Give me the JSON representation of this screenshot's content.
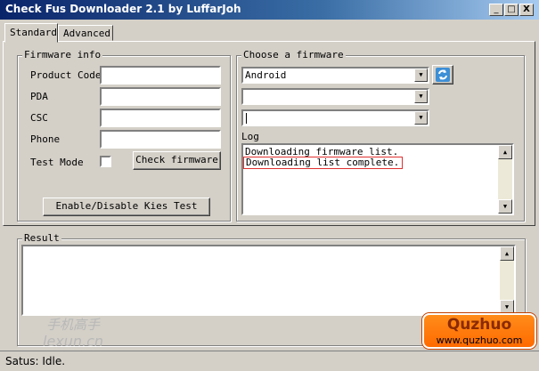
{
  "window": {
    "title": "Check Fus Downloader 2.1 by LuffarJoh"
  },
  "caption_buttons": {
    "minimize": "_",
    "maximize": "□",
    "close": "X"
  },
  "tabs": [
    {
      "label": "Standard",
      "active": true
    },
    {
      "label": "Advanced",
      "active": false
    }
  ],
  "firmware_info": {
    "legend": "Firmware info",
    "product_code_label": "Product Code",
    "product_code_value": "",
    "pda_label": "PDA",
    "pda_value": "",
    "csc_label": "CSC",
    "csc_value": "",
    "phone_label": "Phone",
    "phone_value": "",
    "test_mode_label": "Test Mode",
    "test_mode_checked": false,
    "check_firmware_button": "Check firmware",
    "kies_test_button": "Enable/Disable Kies Test"
  },
  "choose_firmware": {
    "legend": "Choose a firmware",
    "combo1_value": "Android",
    "combo2_value": "",
    "combo3_value": "",
    "refresh_icon": "refresh-icon"
  },
  "log": {
    "label": "Log",
    "lines": [
      "Downloading firmware list.",
      "Downloading list complete."
    ]
  },
  "result": {
    "legend": "Result",
    "text": ""
  },
  "status": {
    "text": "Satus: Idle."
  },
  "watermarks": {
    "left_text": "手机高手",
    "left_sub": "lexun.cn",
    "right_brand": "Quzhuo",
    "right_url": "www.quzhuo.com"
  },
  "colors": {
    "titlebar_start": "#0a246a",
    "titlebar_end": "#a6caf0",
    "highlight": "#e03030",
    "face": "#d4d0c8"
  }
}
